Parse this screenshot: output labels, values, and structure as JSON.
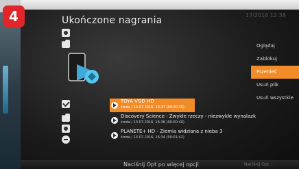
{
  "step_badge": "4",
  "screen": {
    "title": "Ukończone nagrania",
    "top_right": "17/2016 12:38"
  },
  "recordings": [
    {
      "title": "TOYA VOD HD",
      "meta": "środa / 13.07.2016, 16:37 (00:00:39)"
    },
    {
      "title": "Discovery Science - Zwykłe rzeczy - niezwykłe wynalazk",
      "meta": "środa / 13.07.2016, 16:36 (00:00:40)"
    },
    {
      "title": "PLANETE+ HD - Ziemia widziana z nieba 3",
      "meta": "środa / 13.07.2016, 16:34 (00:01:42)"
    }
  ],
  "menu": [
    {
      "label": "Oglądaj"
    },
    {
      "label": "Zablokuj"
    },
    {
      "label": "Przenieś"
    },
    {
      "label": "Usuń plik"
    },
    {
      "label": "Usuń wszystkie"
    }
  ],
  "footer": {
    "hint": "Naciśnij Opt po więcej opcji",
    "right": "Naciśnij Opt..."
  }
}
